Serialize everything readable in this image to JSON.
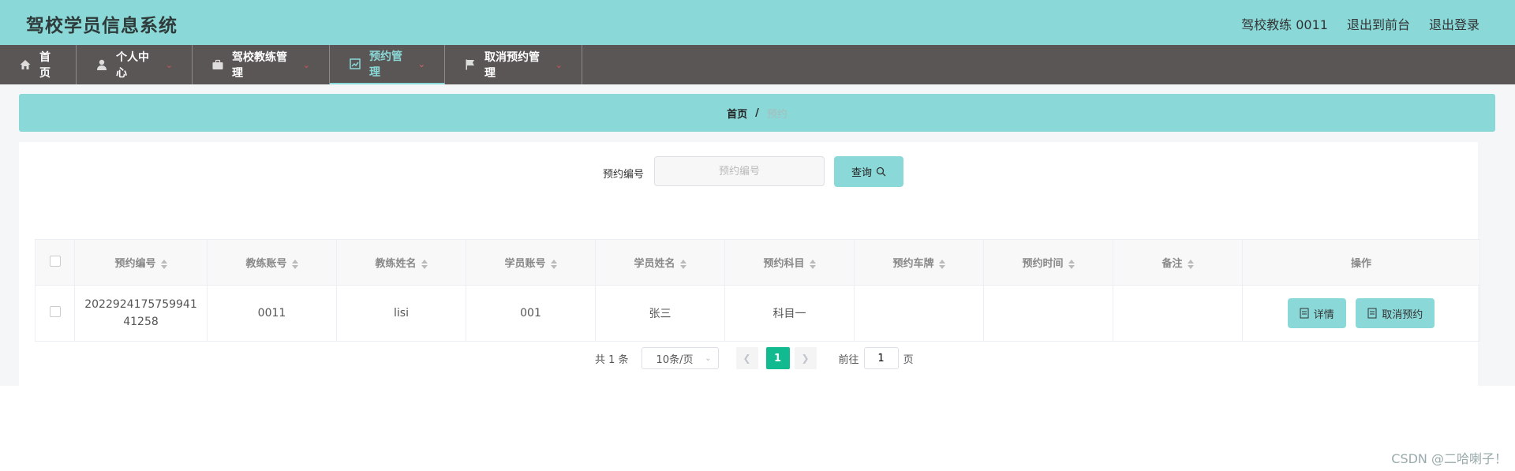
{
  "header": {
    "app_title": "驾校学员信息系统",
    "user_label": "驾校教练 0011",
    "frontend_link": "退出到前台",
    "logout_link": "退出登录"
  },
  "nav": {
    "items": [
      {
        "label": "首页",
        "icon": "home-icon"
      },
      {
        "label": "个人中心",
        "icon": "user-icon"
      },
      {
        "label": "驾校教练管理",
        "icon": "briefcase-icon"
      },
      {
        "label": "预约管理",
        "icon": "chart-icon",
        "active": true
      },
      {
        "label": "取消预约管理",
        "icon": "flag-icon"
      }
    ]
  },
  "breadcrumb": {
    "home": "首页",
    "separator": "/",
    "current": "预约"
  },
  "search": {
    "label": "预约编号",
    "placeholder": "预约编号",
    "value": "",
    "button_label": "查询"
  },
  "table": {
    "columns": [
      "预约编号",
      "教练账号",
      "教练姓名",
      "学员账号",
      "学员姓名",
      "预约科目",
      "预约车牌",
      "预约时间",
      "备注",
      "操作"
    ],
    "rows": [
      {
        "booking_no": "202292417575994141258",
        "coach_account": "0011",
        "coach_name": "lisi",
        "student_account": "001",
        "student_name": "张三",
        "subject": "科目一",
        "plate": "",
        "time": "",
        "note": "",
        "detail_label": "详情",
        "cancel_label": "取消预约"
      }
    ]
  },
  "pagination": {
    "total_text": "共 1 条",
    "page_size": "10条/页",
    "current_page": "1",
    "goto_label": "前往",
    "goto_value": "1",
    "page_suffix": "页"
  },
  "watermark": "CSDN @二哈喇子！",
  "colors": {
    "accent": "#8ad9d8",
    "nav_bg": "#5b5656",
    "page_active": "#11bb8f"
  }
}
